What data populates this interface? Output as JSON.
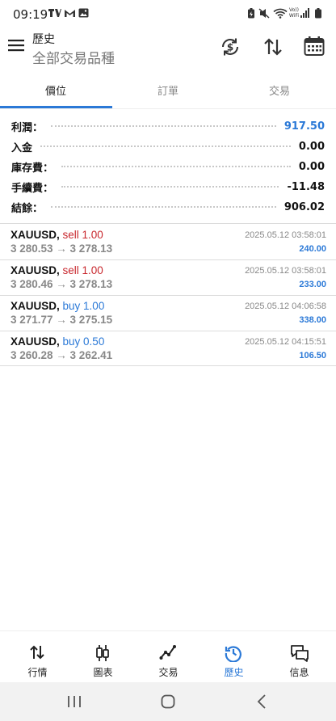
{
  "status": {
    "time": "09:19",
    "network_label_top": "Vo))",
    "network_label_bottom": "WiFi"
  },
  "header": {
    "title": "歷史",
    "subtitle": "全部交易品種"
  },
  "tabs": [
    {
      "label": "價位",
      "active": true
    },
    {
      "label": "訂單",
      "active": false
    },
    {
      "label": "交易",
      "active": false
    }
  ],
  "summary": [
    {
      "label": "利潤：",
      "value": "917.50"
    },
    {
      "label": "入金",
      "value": "0.00"
    },
    {
      "label": "庫存費：",
      "value": "0.00"
    },
    {
      "label": "手續費：",
      "value": "-11.48"
    },
    {
      "label": "結餘：",
      "value": "906.02"
    }
  ],
  "trades": [
    {
      "symbol": "XAUUSD,",
      "side": "sell 1.00",
      "side_type": "sell",
      "prices": "3 280.53 → 3 278.13",
      "time": "2025.05.12 03:58:01",
      "profit": "240.00"
    },
    {
      "symbol": "XAUUSD,",
      "side": "sell 1.00",
      "side_type": "sell",
      "prices": "3 280.46 → 3 278.13",
      "time": "2025.05.12 03:58:01",
      "profit": "233.00"
    },
    {
      "symbol": "XAUUSD,",
      "side": "buy 1.00",
      "side_type": "buy",
      "prices": "3 271.77 → 3 275.15",
      "time": "2025.05.12 04:06:58",
      "profit": "338.00"
    },
    {
      "symbol": "XAUUSD,",
      "side": "buy 0.50",
      "side_type": "buy",
      "prices": "3 260.28 → 3 262.41",
      "time": "2025.05.12 04:15:51",
      "profit": "106.50"
    }
  ],
  "nav": [
    {
      "label": "行情",
      "icon": "quotes-arrows-icon",
      "active": false
    },
    {
      "label": "圖表",
      "icon": "candlestick-chart-icon",
      "active": false
    },
    {
      "label": "交易",
      "icon": "trade-line-icon",
      "active": false
    },
    {
      "label": "歷史",
      "icon": "history-clock-icon",
      "active": true
    },
    {
      "label": "信息",
      "icon": "messages-icon",
      "active": false
    }
  ],
  "colors": {
    "accent": "#2b79d7",
    "sell": "#c8272d"
  }
}
